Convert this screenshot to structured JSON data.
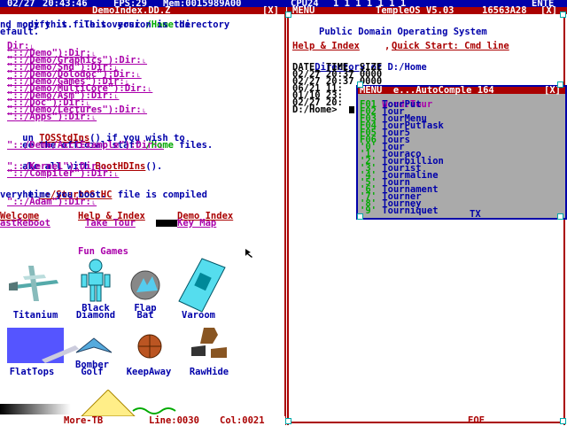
{
  "topbar": {
    "date": "02/27",
    "time": "20:43:46",
    "fps": "FPS:29",
    "mem": "Mem:0015989A00",
    "cpu": "CPU24",
    "cpu_bits": "1 1 1 1 1 1 1",
    "right": "ENTE"
  },
  "left_window": {
    "title": "DemoIndex.DD.Z",
    "lines": [
      {
        "text": "opy this file to your ",
        "hl": "/Home",
        "tail": " directory"
      },
      {
        "text": "nd modify it.  This version is the"
      },
      {
        "text": "efault."
      }
    ],
    "dirs": [
      "Dir:˪",
      "\"::/Demo\"):Dir:˪",
      "\"::/Demo/Graphics\"):Dir:˪",
      "\"::/Demo/Snd\"):Dir:˪",
      "\"::/Demo/Dolodoc\"):Dir:˪",
      "\"::/Demo/Games\"):Dir:˪",
      "\"::/Demo/MultiCore\"):Dir:˪",
      "\"::/Demo/Asm\"):Dir:˪",
      "\"::/Doc\"):Dir:˪",
      "\"::/Demo/Lectures\"):Dir:˪",
      "\"::/Apps\"):Dir:˪"
    ],
    "run_line_a": "un ",
    "run_link": "TOSStdIns",
    "run_line_b": "() if you wish to",
    "staff_line_a": "ee the official staff ",
    "staff_hl": "/Home",
    "staff_line_b": " files.",
    "acct_dir": "\"::/Demo/AcctExample\"):Dir:˪",
    "make_a": "ake all with ",
    "make_link": "BootHDIns",
    "make_b": "().",
    "kernel_dir": "\"::/Kernel\"):Dir:˪",
    "compiler_dir": "\"::/Compiler\"):Dir:˪",
    "the_a": "he ",
    "startos": "::/StartOS.HC",
    "the_b": " file is compiled",
    "every": "very time you boot.",
    "adam_dir": "\"::/Adam\"):Dir:˪",
    "menu1": [
      "Welcome",
      "Help & Index",
      "Demo Index"
    ],
    "menu2": [
      "astReboot",
      "Take Tour",
      "Key Map"
    ],
    "fun_games": "Fun Games",
    "games": [
      {
        "name": "Titanium",
        "icon": "jet-icon"
      },
      {
        "name": "Black Diamond",
        "line1": "Black",
        "line2": "Diamond",
        "icon": "robot-icon"
      },
      {
        "name": "Flap Bat",
        "line1": "Flap",
        "line2": "Bat",
        "icon": "bat-icon"
      },
      {
        "name": "Varoom",
        "icon": "car-icon"
      },
      {
        "name": "FlatTops",
        "icon": "carrier-icon"
      },
      {
        "name": "Bomber Golf",
        "line1": "Bomber",
        "line2": "Golf",
        "icon": "bomber-icon"
      },
      {
        "name": "KeepAway",
        "icon": "ball-icon"
      },
      {
        "name": "RawHide",
        "icon": "horses-icon"
      }
    ],
    "status": {
      "more": "More-TB",
      "line": "Line:0030",
      "col": "Col:0021"
    }
  },
  "right_window": {
    "title": "TempleOS V5.03",
    "menu": "MENU",
    "sub_title": "Public Domain Operating System",
    "help_link": "Help & Index",
    "quick_link": "Quick Start: Cmd line",
    "dir_label": "Directory",
    "dir_path": " of D:/Home",
    "headers": "DATE_ TIME_ SIZE",
    "rows": [
      "02/27 20:37 0000",
      "02/27 20:37 0000",
      "06/21 11:",
      "01/10 23:",
      "02/27 20:",
      "D:/Home>"
    ],
    "status": "EOF",
    "hdr_right": "16563A28"
  },
  "autocomplete": {
    "title": "MENU  e...AutoComple 164",
    "word_prefix": "Word:",
    "word": "Tour",
    "items": [
      {
        "key": "F01",
        "word": "TourPut"
      },
      {
        "key": "F02",
        "word": "Tour"
      },
      {
        "key": "F03",
        "word": "TourMenu"
      },
      {
        "key": "F04",
        "word": "TourPutTask"
      },
      {
        "key": "F05",
        "word": "Tour5"
      },
      {
        "key": "F06",
        "word": "Tours"
      },
      {
        "key": "'0'",
        "word": "Tour"
      },
      {
        "key": "'1'",
        "word": "Touraco"
      },
      {
        "key": "'2'",
        "word": "Tourbillion"
      },
      {
        "key": "'3'",
        "word": "Tourist"
      },
      {
        "key": "'4'",
        "word": "Tourmaline"
      },
      {
        "key": "'5'",
        "word": "Tourn"
      },
      {
        "key": "'6'",
        "word": "Tournament"
      },
      {
        "key": "'7'",
        "word": "Tourner"
      },
      {
        "key": "'8'",
        "word": "Tourney"
      },
      {
        "key": "'9'",
        "word": "Tourniquet"
      }
    ],
    "footer": "TX"
  }
}
